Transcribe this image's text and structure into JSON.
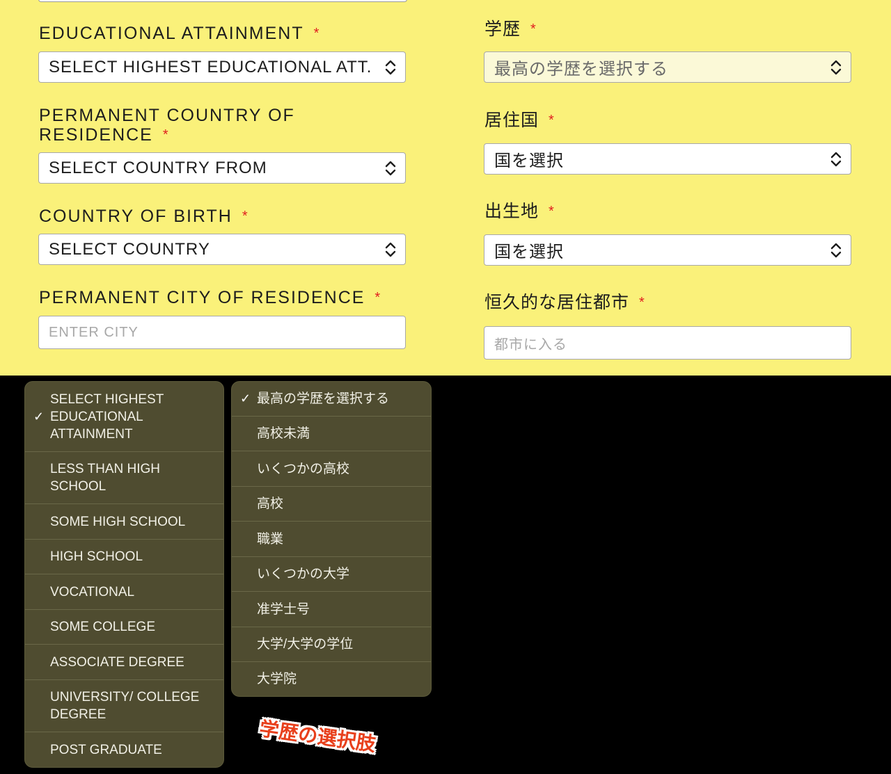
{
  "form": {
    "left": {
      "education_label": "EDUCATIONAL ATTAINMENT",
      "education_value": "SELECT HIGHEST EDUCATIONAL ATT.",
      "residence_label_line1": "PERMANENT COUNTRY OF",
      "residence_label_line2": "RESIDENCE",
      "residence_value": "SELECT COUNTRY FROM",
      "birth_label": "COUNTRY OF BIRTH",
      "birth_value": "SELECT COUNTRY",
      "city_label": "PERMANENT CITY OF RESIDENCE",
      "city_placeholder": "ENTER CITY"
    },
    "right": {
      "education_label": "学歴",
      "education_value": "最高の学歴を選択する",
      "residence_label": "居住国",
      "residence_value": "国を選択",
      "birth_label": "出生地",
      "birth_value": "国を選択",
      "city_label": "恒久的な居住都市",
      "city_placeholder": "都市に入る"
    },
    "required_mark": "*"
  },
  "menu_en": {
    "items": [
      {
        "line1": "SELECT HIGHEST",
        "line2": "EDUCATIONAL",
        "line3": "ATTAINMENT"
      },
      {
        "line1": "LESS THAN HIGH",
        "line2": "SCHOOL"
      },
      {
        "line1": "SOME HIGH SCHOOL"
      },
      {
        "line1": "HIGH SCHOOL"
      },
      {
        "line1": "VOCATIONAL"
      },
      {
        "line1": "SOME COLLEGE"
      },
      {
        "line1": "ASSOCIATE DEGREE"
      },
      {
        "line1": "UNIVERSITY/ COLLEGE",
        "line2": "DEGREE"
      },
      {
        "line1": "POST GRADUATE"
      }
    ],
    "selected_index": 0
  },
  "menu_jp": {
    "items": [
      "最高の学歴を選択する",
      "高校未満",
      "いくつかの高校",
      "高校",
      "職業",
      "いくつかの大学",
      "准学士号",
      "大学/大学の学位",
      "大学院"
    ],
    "selected_index": 0
  },
  "check_glyph": "✓",
  "caption": "学歴の選択肢",
  "colors": {
    "form_background": "#faf17a",
    "menu_background": "#4f4c30",
    "required": "#e02020",
    "caption": "#e8401c"
  }
}
